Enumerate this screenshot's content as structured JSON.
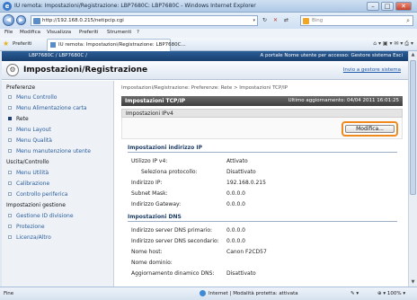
{
  "window": {
    "title": "IU remota: Impostazioni/Registrazione: LBP7680C: LBP7680C - Windows Internet Explorer",
    "minimize": "–",
    "maximize": "□",
    "close": "✕"
  },
  "address": {
    "url": "http://192.168.0.215/netipcip.cgi",
    "search_placeholder": "Bing"
  },
  "menu": [
    "File",
    "Modifica",
    "Visualizza",
    "Preferiti",
    "Strumenti",
    "?"
  ],
  "favorites": {
    "label": "Preferiti",
    "tab_title": "IU remota: Impostazioni/Registrazione: LBP7680C..."
  },
  "device": {
    "name": "LBP7680C / LBP7680C /",
    "right": "A portale   Nome utente per accesso: Gestore sistema   Esci",
    "page_title": "Impostazioni/Registrazione",
    "admin_link": "Invio a gestore sistema"
  },
  "sidebar": {
    "sections": [
      {
        "title": "Preferenze",
        "items": [
          {
            "label": "Menu Controllo",
            "active": false
          },
          {
            "label": "Menu Alimentazione carta",
            "active": false
          },
          {
            "label": "Rete",
            "active": true
          },
          {
            "label": "Menu Layout",
            "active": false
          },
          {
            "label": "Menu Qualità",
            "active": false
          },
          {
            "label": "Menu manutenzione utente",
            "active": false
          }
        ]
      },
      {
        "title": "Uscita/Controllo",
        "items": [
          {
            "label": "Menu Utilità",
            "active": false
          },
          {
            "label": "Calibrazione",
            "active": false
          },
          {
            "label": "Controllo periferica",
            "active": false
          }
        ]
      },
      {
        "title": "Impostazioni gestione",
        "items": [
          {
            "label": "Gestione ID divisione",
            "active": false
          },
          {
            "label": "Protezione",
            "active": false
          },
          {
            "label": "Licenza/Altro",
            "active": false
          }
        ]
      }
    ]
  },
  "main": {
    "breadcrumb": "Impostazioni/Registrazione: Preferenze: Rete > Impostazioni TCP/IP",
    "section_title": "Impostazioni TCP/IP",
    "last_update": "Ultimo aggiornamento: 04/04 2011 16:01:25",
    "sub_title": "Impostazioni IPv4",
    "edit_button": "Modifica...",
    "groups": [
      {
        "title": "Impostazioni indirizzo IP",
        "rows": [
          {
            "label": "Utilizzo IP v4:",
            "value": "Attivato",
            "indent": false
          },
          {
            "label": "Seleziona protocollo:",
            "value": "Disattivato",
            "indent": true
          },
          {
            "label": "Indirizzo IP:",
            "value": "192.168.0.215",
            "indent": false
          },
          {
            "label": "Subnet Mask:",
            "value": "0.0.0.0",
            "indent": false
          },
          {
            "label": "Indirizzo Gateway:",
            "value": "0.0.0.0",
            "indent": false
          }
        ]
      },
      {
        "title": "Impostazioni DNS",
        "rows": [
          {
            "label": "Indirizzo server DNS primario:",
            "value": "0.0.0.0",
            "indent": false
          },
          {
            "label": "Indirizzo server DNS secondario:",
            "value": "0.0.0.0",
            "indent": false
          },
          {
            "label": "Nome host:",
            "value": "Canon F2CD57",
            "indent": false
          },
          {
            "label": "Nome dominio:",
            "value": "",
            "indent": false
          },
          {
            "label": "Aggiornamento dinamico DNS:",
            "value": "Disattivato",
            "indent": false
          }
        ]
      }
    ]
  },
  "status": {
    "left": "Fine",
    "zone": "Internet | Modalità protetta: attivata",
    "zoom": "100%"
  },
  "colors": {
    "accent": "#f08a1e",
    "device_bar": "#173f6f",
    "section_bar": "#3d3d3d"
  }
}
